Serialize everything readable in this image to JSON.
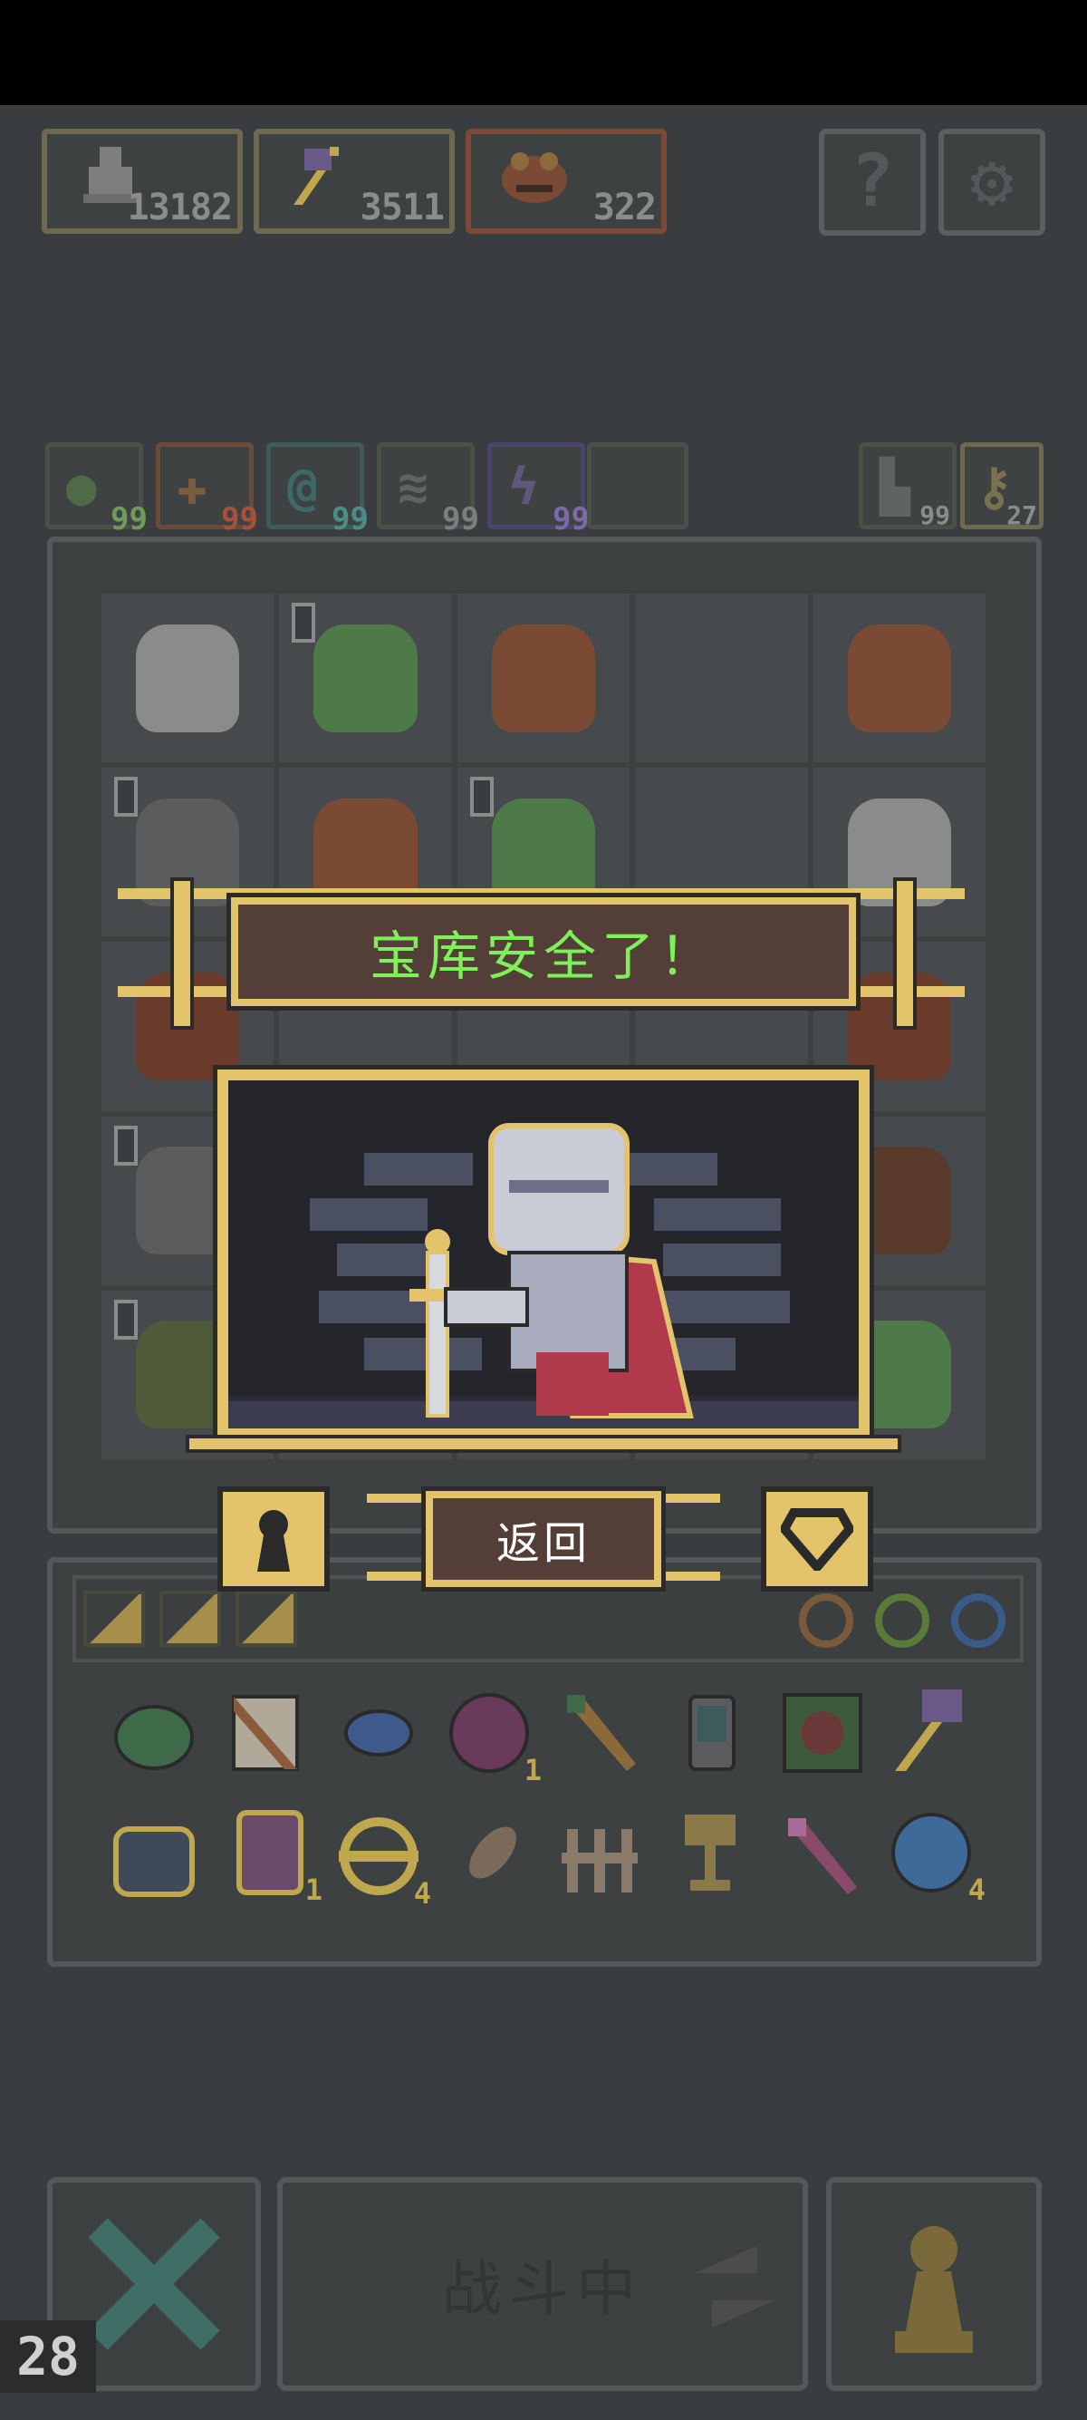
{
  "colors": {
    "gold": "#e3c46a",
    "plaque_bg": "#533f38",
    "title_green": "#7df05a",
    "background": "#3a3d40"
  },
  "resources": {
    "soldiers": "13182",
    "staffs": "3511",
    "toads": "322"
  },
  "top_buttons": {
    "help_icon": "question-icon",
    "settings_icon": "gear-icon"
  },
  "elements": [
    {
      "icon": "nature-icon",
      "value": "99"
    },
    {
      "icon": "fire-icon",
      "value": "99"
    },
    {
      "icon": "water-icon",
      "value": "99"
    },
    {
      "icon": "wind-icon",
      "value": "99"
    },
    {
      "icon": "lightning-icon",
      "value": "99"
    }
  ],
  "counters": {
    "boots": "99",
    "key": "27"
  },
  "dialog": {
    "title": "宝库安全了！",
    "back_label": "返回"
  },
  "inventory": {
    "item_counts": [
      "1",
      "1",
      "4",
      "4"
    ]
  },
  "bottom": {
    "fight_label": "战斗中",
    "frame_counter": "28"
  }
}
